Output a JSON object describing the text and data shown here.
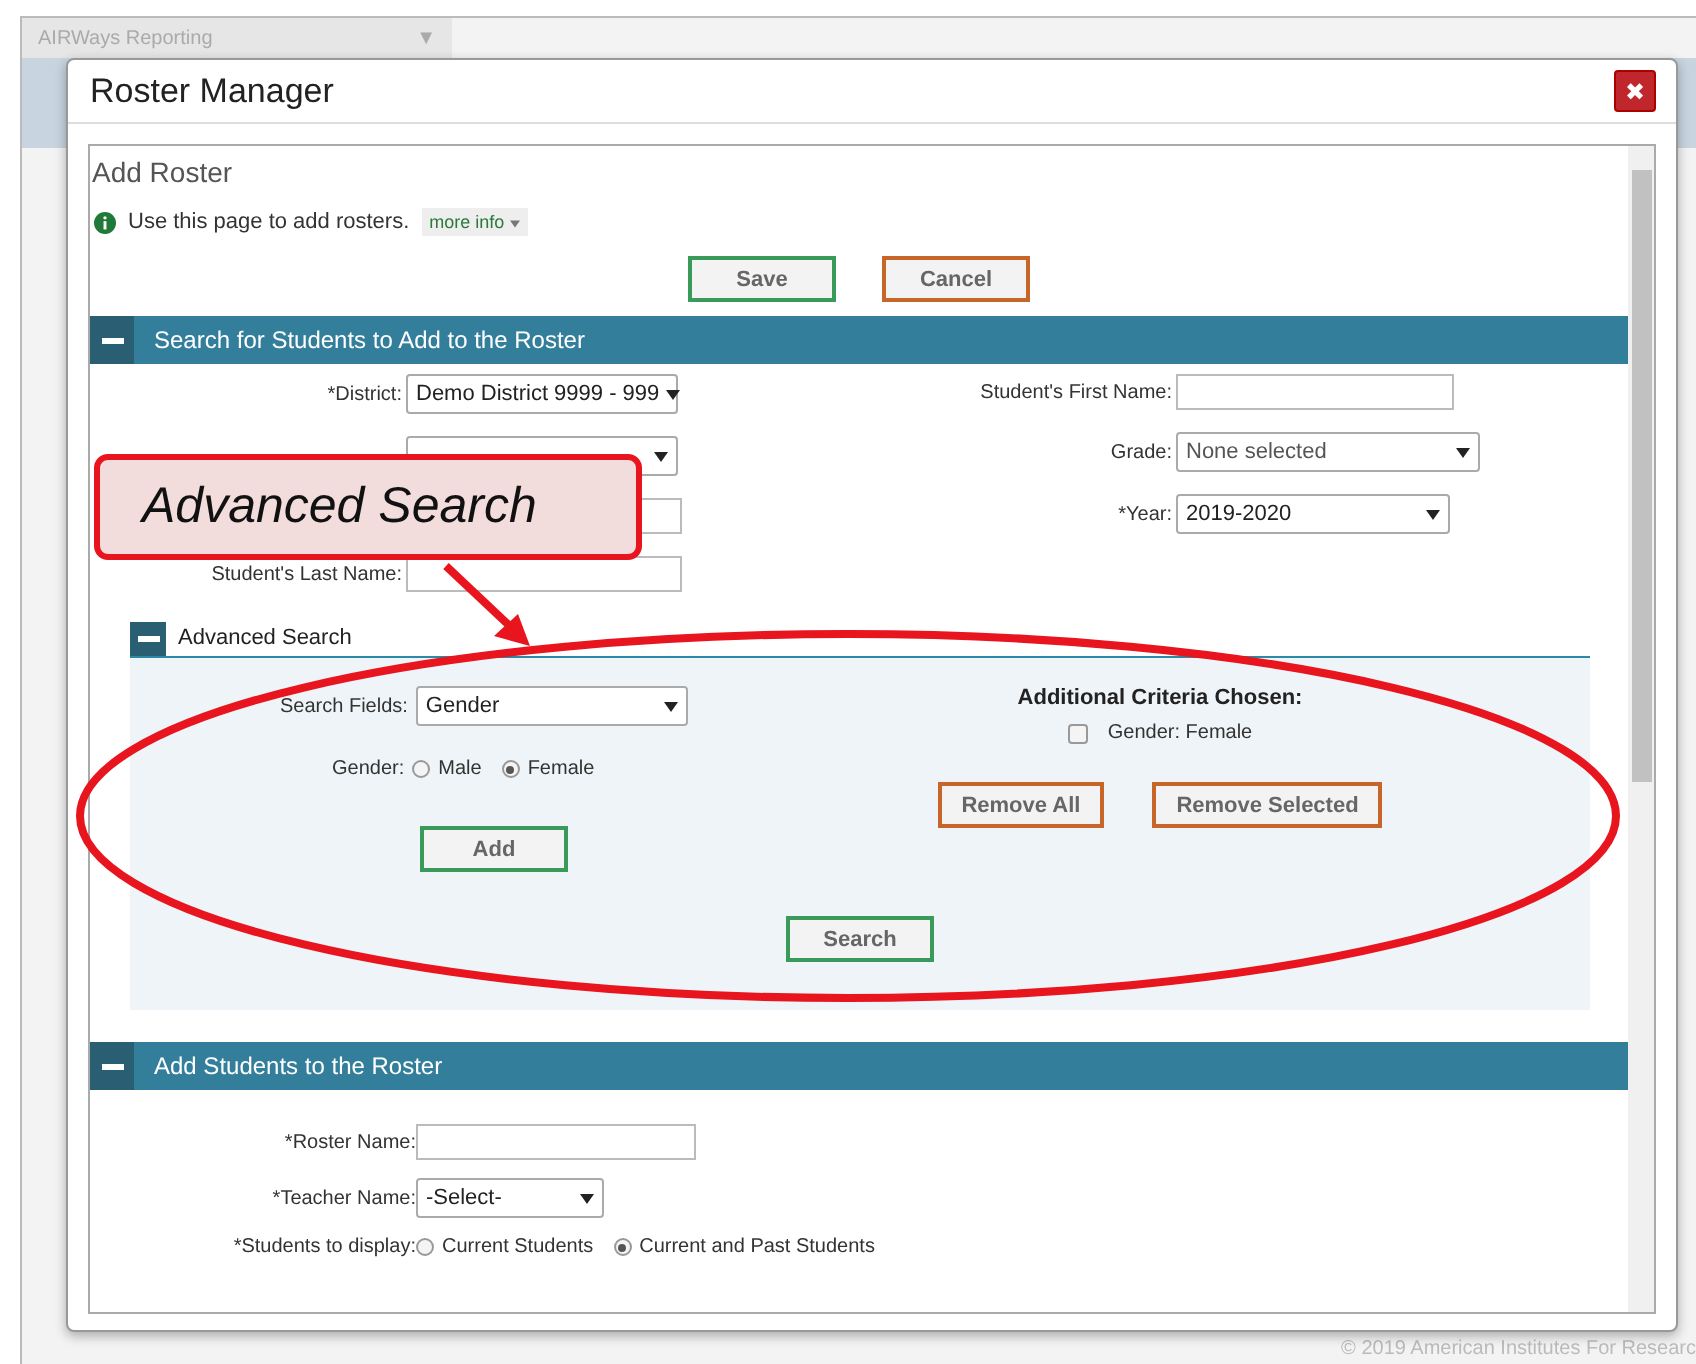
{
  "app_bar": {
    "title": "AIRWays Reporting",
    "caret": "▼"
  },
  "dialog": {
    "title": "Roster Manager",
    "close": "✖"
  },
  "page": {
    "title": "Add Roster",
    "info": "Use this page to add rosters.",
    "more_info": "more info",
    "buttons": [
      {
        "label": "Save",
        "kind": "primary"
      },
      {
        "label": "Cancel",
        "kind": "secondary"
      }
    ]
  },
  "search_section": {
    "title": "Search for Students to Add to the Roster",
    "left_fields": [
      {
        "label": "*District:",
        "kind": "select",
        "value": "Demo District 9999 - 999"
      },
      {
        "kind": "select"
      },
      {
        "kind": "input"
      },
      {
        "label": "Student's Last Name:",
        "kind": "input"
      }
    ],
    "right_fields": [
      {
        "label": "Student's First Name:",
        "kind": "input"
      },
      {
        "label": "Grade:",
        "kind": "multiselect",
        "value": "None selected"
      },
      {
        "label": "*Year:",
        "kind": "select",
        "value": "2019-2020"
      }
    ]
  },
  "advanced_search": {
    "title": "Advanced Search",
    "search_fields_label": "Search Fields:",
    "search_field_value": "Gender",
    "gender_label": "Gender:",
    "gender_options": [
      {
        "label": "Male",
        "selected": false
      },
      {
        "label": "Female",
        "selected": true
      }
    ],
    "add_button": "Add",
    "criteria_title": "Additional Criteria Chosen:",
    "criteria": [
      {
        "label": "Gender: Female",
        "checked": false
      }
    ],
    "criteria_buttons": [
      "Remove All",
      "Remove Selected"
    ],
    "search_button": "Search"
  },
  "add_section": {
    "title": "Add Students to the Roster",
    "roster_name_label": "*Roster Name:",
    "teacher_label": "*Teacher Name:",
    "teacher_value": "-Select-",
    "display_label": "*Students to display:",
    "display_options": [
      {
        "label": "Current Students",
        "selected": false
      },
      {
        "label": "Current and Past Students",
        "selected": true
      }
    ]
  },
  "footer": "© 2019 American Institutes For Researc",
  "callout": {
    "text": "Advanced Search"
  }
}
